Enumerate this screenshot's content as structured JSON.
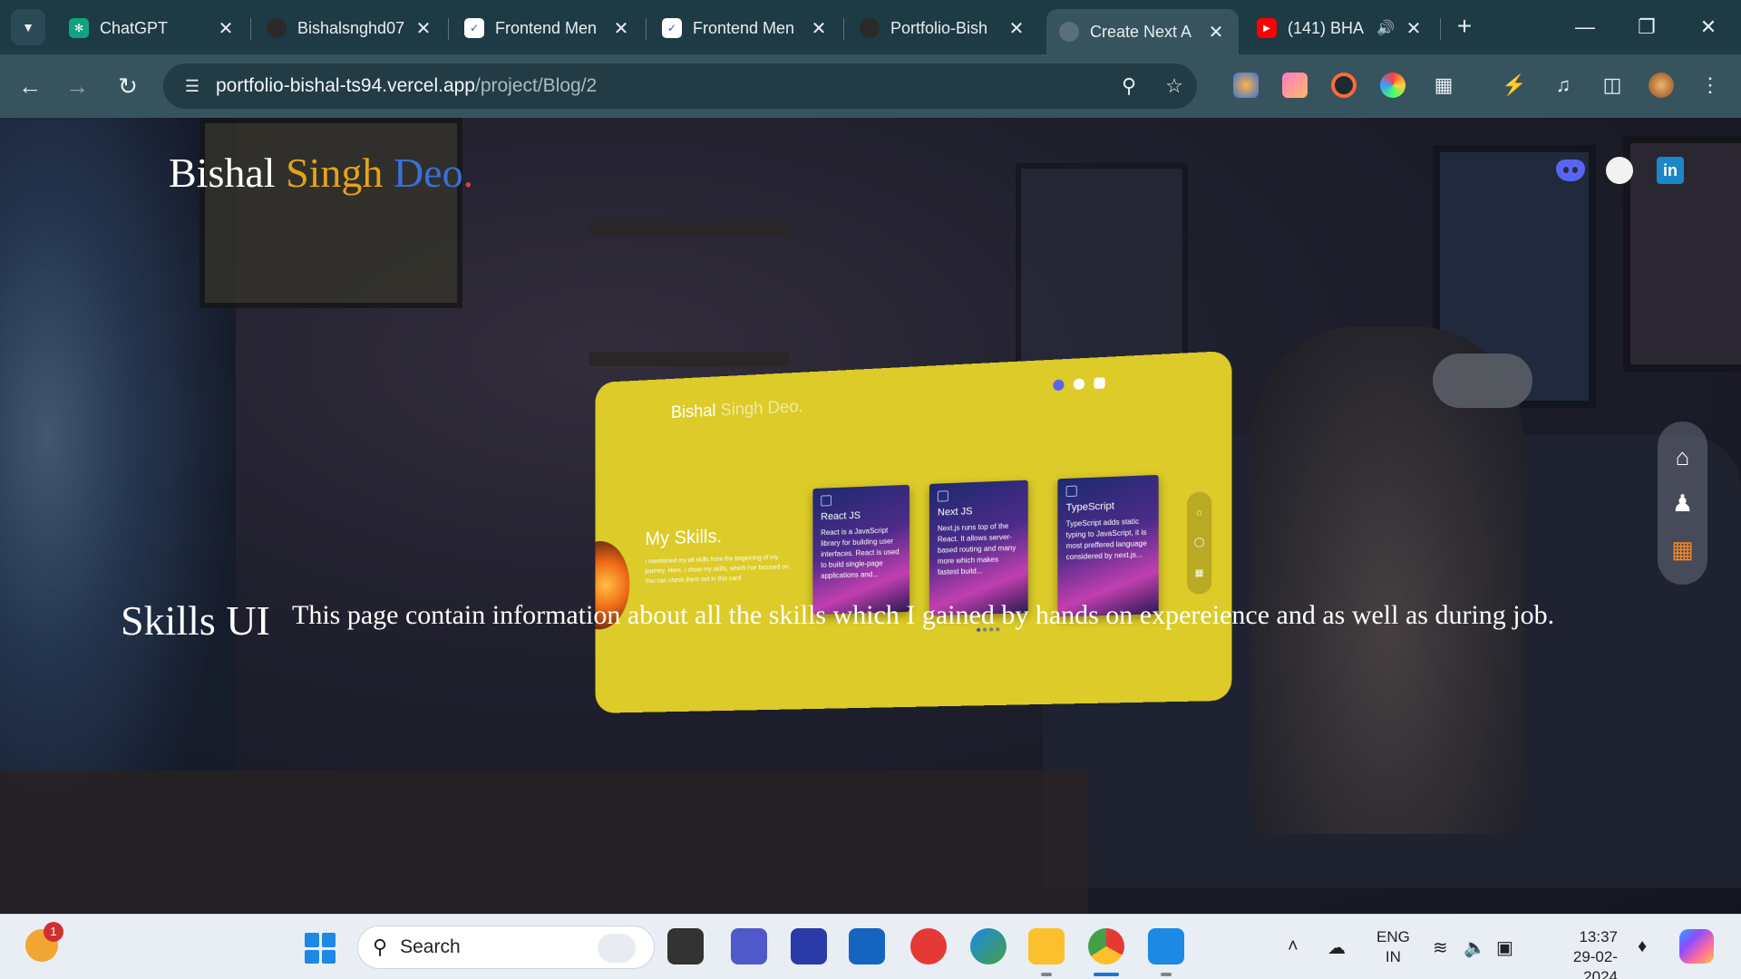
{
  "browser": {
    "tabs": [
      {
        "title": "ChatGPT",
        "favicon": "chatgpt-icon",
        "active": false
      },
      {
        "title": "Bishalsnghd07",
        "favicon": "github-icon",
        "active": false
      },
      {
        "title": "Frontend Men",
        "favicon": "frontend-mentor-icon",
        "active": false
      },
      {
        "title": "Frontend Men",
        "favicon": "frontend-mentor-icon",
        "active": false
      },
      {
        "title": "Portfolio-Bish",
        "favicon": "github-icon",
        "active": false
      },
      {
        "title": "Create Next A",
        "favicon": "globe-icon",
        "active": true
      },
      {
        "title": "(141) BHA",
        "favicon": "youtube-icon",
        "active": false,
        "audio": true
      }
    ],
    "url_host": "portfolio-bishal-ts94.vercel.app",
    "url_path": "/project/Blog/2"
  },
  "page": {
    "brand": {
      "part1": "Bishal",
      "part2": "Singh",
      "part3": "Deo",
      "part4": "."
    },
    "social": [
      "discord-icon",
      "github-icon",
      "linkedin-icon"
    ],
    "preview": {
      "brand1": "Bishal",
      "brand2": "Singh Deo.",
      "title": "My Skills.",
      "desc": "I mentioned my all skills from the beginning of my journey. Here, I show my skills, which I've focused on. You can check them out in this card.",
      "cards": [
        {
          "name": "React JS",
          "text": "React is a JavaScript library for building user interfaces. React is used to build single-page applications and..."
        },
        {
          "name": "Next JS",
          "text": "Next.js runs top of the React. It allows server-based routing and many more which makes fastest build..."
        },
        {
          "name": "TypeScript",
          "text": "TypeScript adds static typing to JavaScript, it is most preffered language considered by next.js..."
        }
      ]
    },
    "section_title": "Skills UI",
    "section_desc": "This page contain information about all the skills which I gained by hands on expereience and as well as during job.",
    "side_nav": [
      "home-icon",
      "user-icon",
      "grid-icon"
    ]
  },
  "taskbar": {
    "notification_count": "1",
    "search_placeholder": "Search",
    "lang_line1": "ENG",
    "lang_line2": "IN",
    "time": "13:37",
    "date": "29-02-2024"
  },
  "colors": {
    "brand_white": "#ffffff",
    "brand_gold": "#e3a319",
    "brand_blue": "#3b6fd8",
    "brand_red": "#e0403a",
    "preview_yellow": "#dccb28",
    "accent_orange": "#f08a2a"
  }
}
